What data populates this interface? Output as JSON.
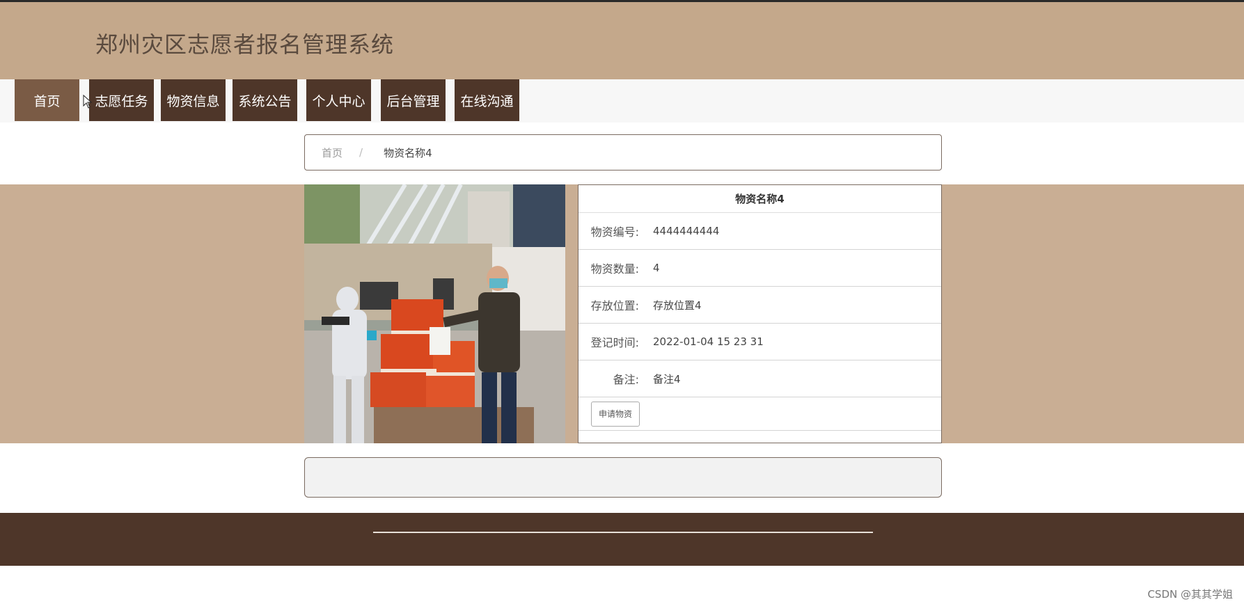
{
  "header": {
    "title": "郑州灾区志愿者报名管理系统"
  },
  "nav": {
    "items": [
      {
        "label": "首页",
        "active": true
      },
      {
        "label": "志愿任务"
      },
      {
        "label": "物资信息"
      },
      {
        "label": "系统公告"
      },
      {
        "label": "个人中心"
      },
      {
        "label": "后台管理"
      },
      {
        "label": "在线沟通"
      }
    ]
  },
  "breadcrumb": {
    "home": "首页",
    "separator": "/",
    "current": "物资名称4"
  },
  "detail": {
    "title": "物资名称4",
    "rows": [
      {
        "label": "物资编号:",
        "value": "4444444444"
      },
      {
        "label": "物资数量:",
        "value": "4"
      },
      {
        "label": "存放位置:",
        "value": "存放位置4"
      },
      {
        "label": "登记时间:",
        "value": "2022-01-04 15 23 31"
      },
      {
        "label": "备注:",
        "value": "备注4"
      }
    ],
    "apply_label": "申请物资"
  },
  "watermark": "CSDN @其其学姐",
  "colors": {
    "header": "#c4a88b",
    "nav": "#4e3629",
    "nav_active": "#7a5b45",
    "band": "#c9ae94",
    "footer": "#4e3629"
  }
}
